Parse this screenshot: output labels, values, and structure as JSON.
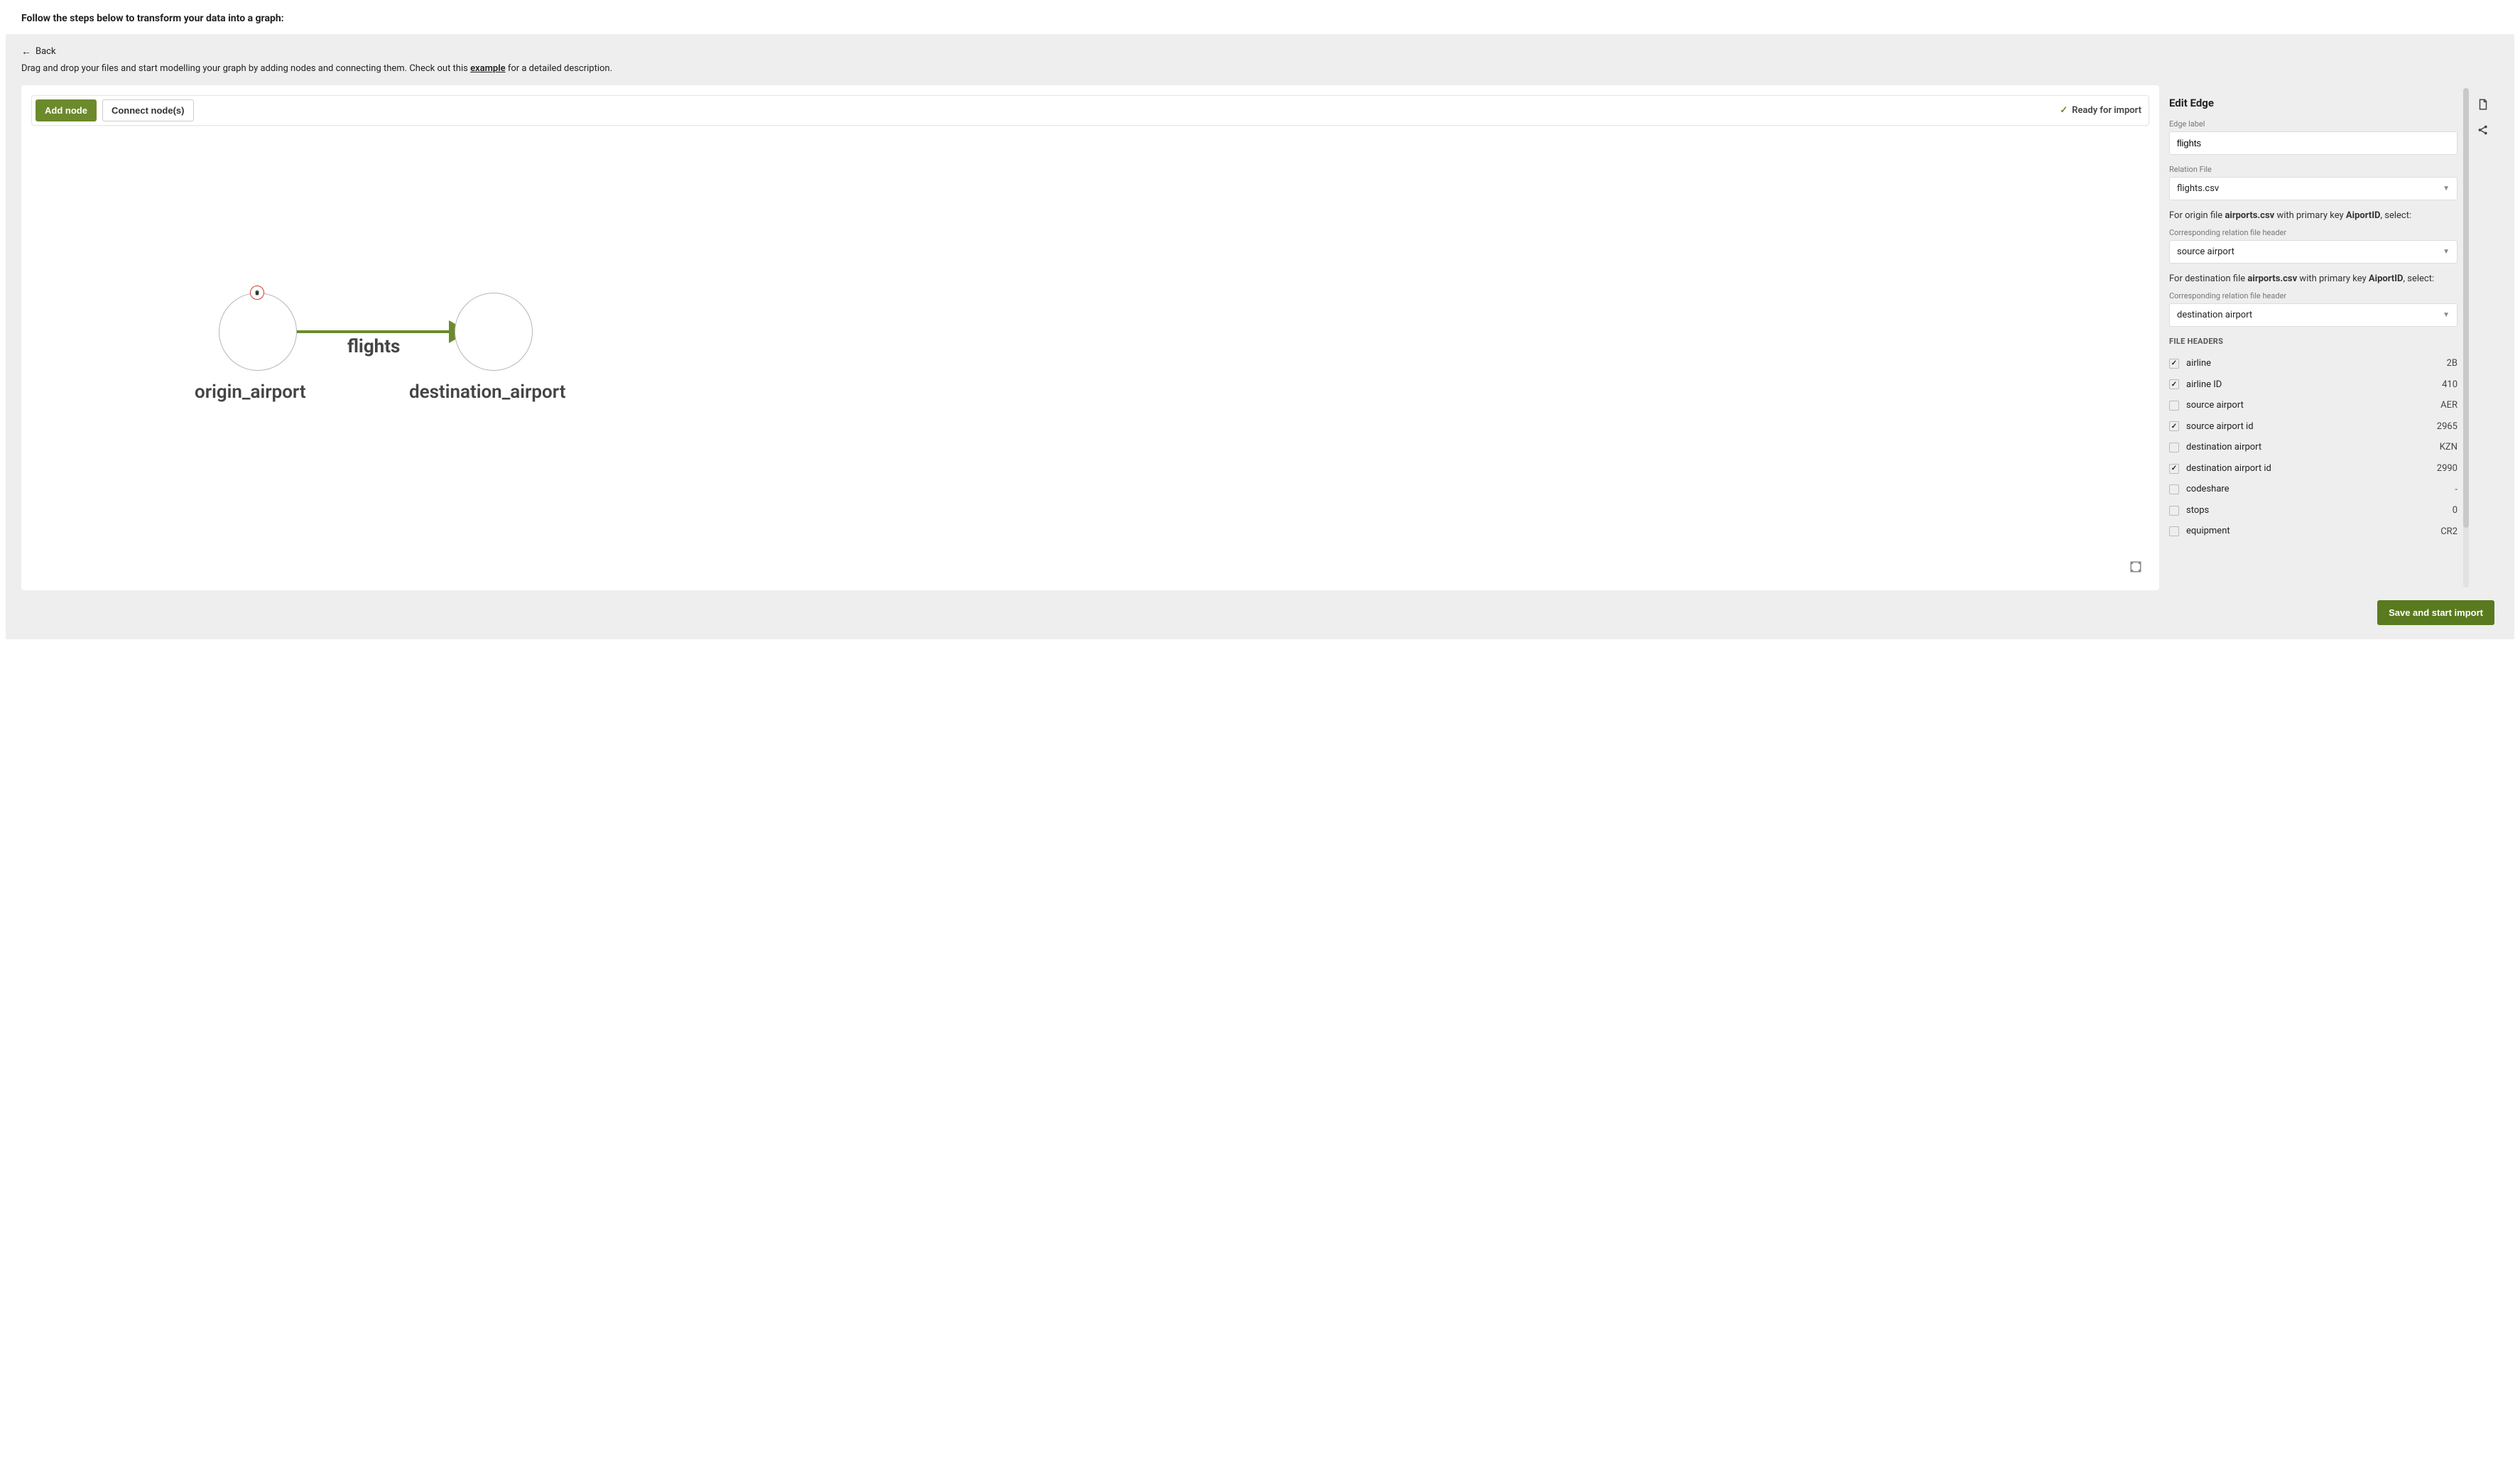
{
  "page": {
    "title": "Follow the steps below to transform your data into a graph:"
  },
  "nav": {
    "back_label": "Back"
  },
  "instructions": {
    "prefix": "Drag and drop your files and start modelling your graph by adding nodes and connecting them. Check out this ",
    "link_text": "example",
    "suffix": " for a detailed description."
  },
  "toolbar": {
    "add_node": "Add node",
    "connect_nodes": "Connect node(s)",
    "ready_status": "Ready for import"
  },
  "graph": {
    "origin_label": "origin_airport",
    "destination_label": "destination_airport",
    "edge_label": "flights"
  },
  "edit_panel": {
    "title": "Edit Edge",
    "edge_label_field": "Edge label",
    "edge_label_value": "flights",
    "relation_file_field": "Relation File",
    "relation_file_value": "flights.csv",
    "origin_helper_prefix": "For origin file ",
    "origin_helper_file": "airports.csv",
    "origin_helper_mid": " with primary key ",
    "origin_helper_key": "AiportID",
    "origin_helper_suffix": ", select:",
    "corr_header_label": "Corresponding relation file header",
    "origin_header_value": "source airport",
    "dest_helper_prefix": "For destination file ",
    "dest_helper_file": "airports.csv",
    "dest_helper_mid": " with primary key ",
    "dest_helper_key": "AiportID",
    "dest_helper_suffix": ", select:",
    "dest_header_value": "destination airport",
    "file_headers_title": "FILE HEADERS",
    "headers": [
      {
        "name": "airline",
        "value": "2B",
        "checked": true
      },
      {
        "name": "airline ID",
        "value": "410",
        "checked": true
      },
      {
        "name": "source airport",
        "value": "AER",
        "checked": false
      },
      {
        "name": "source airport id",
        "value": "2965",
        "checked": true
      },
      {
        "name": "destination airport",
        "value": "KZN",
        "checked": false
      },
      {
        "name": "destination airport id",
        "value": "2990",
        "checked": true
      },
      {
        "name": "codeshare",
        "value": "-",
        "checked": false
      },
      {
        "name": "stops",
        "value": "0",
        "checked": false
      },
      {
        "name": "equipment",
        "value": "CR2",
        "checked": false
      }
    ]
  },
  "footer": {
    "save_label": "Save and start import"
  },
  "icons": {
    "delete": "trash-icon",
    "fit": "fit-icon",
    "file": "file-icon",
    "share": "share-icon"
  }
}
